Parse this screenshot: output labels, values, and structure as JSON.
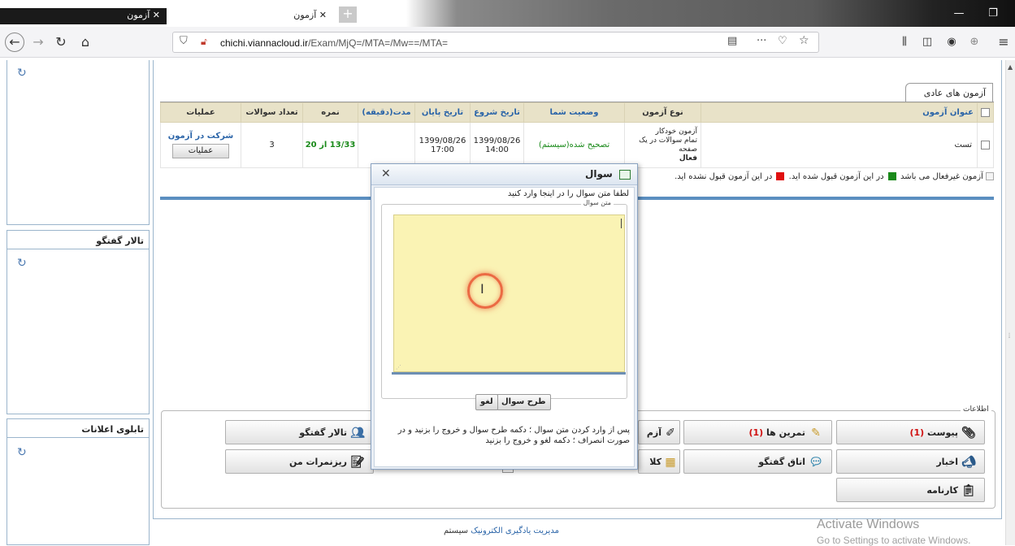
{
  "browser": {
    "tabs": [
      {
        "label": "آزمون",
        "close": "✕"
      },
      {
        "label": "آزمون",
        "close": "✕"
      }
    ],
    "new_tab": "+",
    "window_controls": {
      "minimize": "—",
      "restore": "❐"
    },
    "url_host": "chichi.viannacloud.ir",
    "url_path": "/Exam/MjQ=/MTA=/Mw==/MTA=",
    "icons": [
      "back-icon",
      "forward-icon",
      "reload-icon",
      "home-icon",
      "shield-icon",
      "insecure-lock-icon",
      "reader-icon",
      "more-icon",
      "pocket-icon",
      "star-icon",
      "library-icon",
      "sidebar-icon",
      "account-icon",
      "extension-icon",
      "menu-icon"
    ]
  },
  "sidebar": {
    "forum_title": "تالار گفتگو",
    "notice_title": "تابلوی اعلانات"
  },
  "exams": {
    "tab_label": "آزمون های عادی",
    "headers": [
      "عنوان آزمون",
      "نوع آزمون",
      "وضعیت شما",
      "تاریخ شروع",
      "تاریخ پایان",
      "مدت(دقیقه)",
      "نمره",
      "تعداد سوالات",
      "عملیات"
    ],
    "row": {
      "title": "تست",
      "type_line1": "آزمون خودکار",
      "type_line2": "تمام سوالات در یک صفحه",
      "type_line3": "فعال",
      "status": "تصحیح شده(سیستم)",
      "start_date": "1399/08/26",
      "start_time": "14:00",
      "end_date": "1399/08/26",
      "end_time": "17:00",
      "duration": "",
      "score": "13/33 از 20",
      "question_count": "3",
      "join_link": "شرکت در آزمون",
      "ops_button": "عملیات"
    },
    "legend_part1": "آزمون غیرفعال می باشد",
    "legend_part2": "در این آزمون قبول شده اید.",
    "legend_part3": "در این آزمون قبول نشده اید.",
    "colors": {
      "passed": "#1a8a1a",
      "failed": "#e01010"
    }
  },
  "info": {
    "legend": "اطلاعات",
    "buttons": {
      "pivast": "پیوست",
      "pivast_count": "(1)",
      "tamrin": "تمرین ها",
      "tamrin_count": "(1)",
      "azmoon_partial": "آزم",
      "forum": "تالار گفتگو",
      "news": "اخبار",
      "chatroom": "اتاق گفتگو",
      "class_partial": "کلا",
      "my_grades": "ریزنمرات من",
      "report": "کارنامه"
    }
  },
  "dialog": {
    "title": "سوال",
    "close": "✕",
    "instruction": "لطفا متن سوال را در اینجا وارد کنید",
    "field_label": "متن سوال",
    "submit_button": "طرح سوال",
    "cancel_button": "لغو",
    "note": "پس از وارد کردن متن سوال ؛ دکمه طرح سوال و خروج را بزنید و در صورت انصراف ؛ دکمه لغو و خروج را بزنید"
  },
  "footer": {
    "prefix": "سیستم",
    "link": "مدیریت یادگیری الکترونیک"
  },
  "watermark": {
    "line1": "Activate Windows",
    "line2": "Go to Settings to activate Windows."
  }
}
